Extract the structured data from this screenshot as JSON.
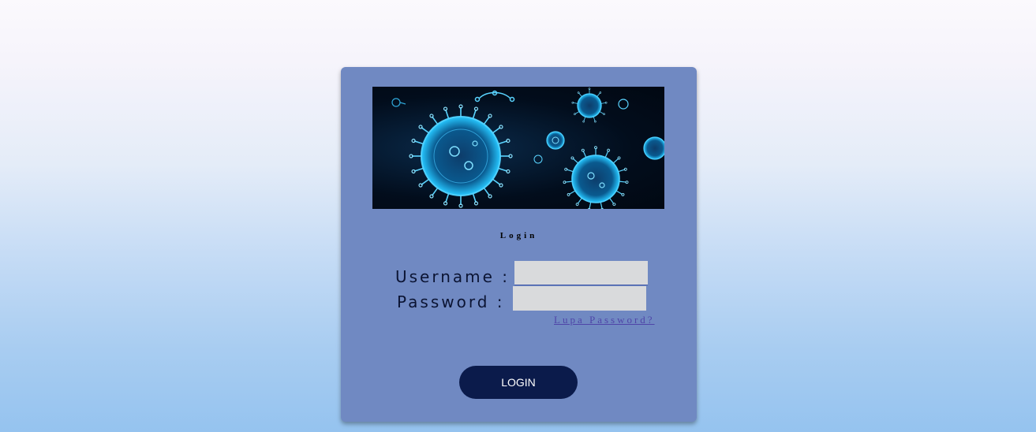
{
  "login": {
    "title": "Login",
    "username_label": "Username :",
    "password_label": "Password :",
    "username_value": "",
    "password_value": "",
    "forgot_password": "Lupa Password?",
    "submit_label": "LOGIN"
  },
  "banner": {
    "image": "virus-illustration"
  },
  "colors": {
    "card": "#7089c2",
    "button": "#0b1b4b",
    "input": "#d9dadc",
    "link": "#4f45a8"
  }
}
